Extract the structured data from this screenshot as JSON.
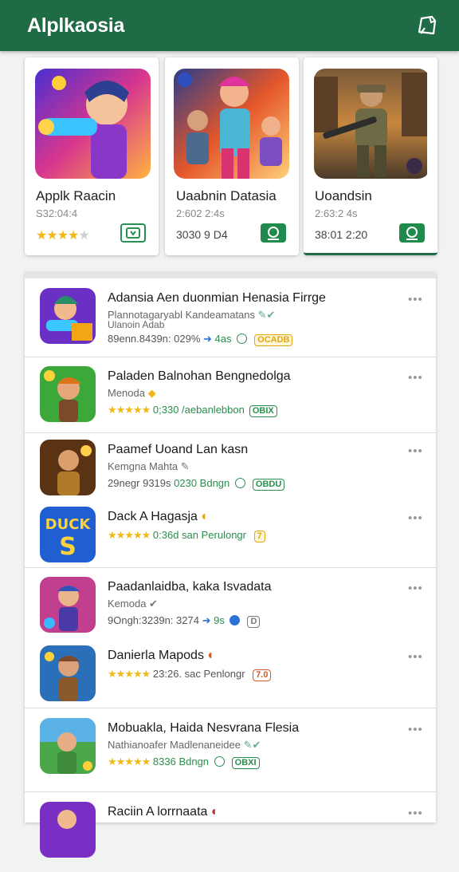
{
  "app": {
    "title": "Alplkaosia",
    "action_icon": "note-edit-icon",
    "accent": "#1e6b45"
  },
  "featured": [
    {
      "name": "Applk Raacin",
      "meta": "S32:04:4",
      "rating": 4,
      "badge_style": "outline",
      "badge_icon": "install-icon"
    },
    {
      "name": "Uaabnin Datasia",
      "meta": "2:602 2:4s",
      "extra": "3030 9 D4",
      "badge_style": "filled",
      "badge_icon": "install-icon",
      "selected": false
    },
    {
      "name": "Uoandsin",
      "meta": "2:63:2 4s",
      "extra": "38:01 2:20",
      "badge_style": "filled",
      "badge_icon": "install-icon",
      "selected": true
    }
  ],
  "list": [
    {
      "title": "Adansia Aen duonmian Henasia Firrge",
      "subtitle": "Plannotagaryabl Kandeamatans",
      "subtitle2": "Ulanoin Adab",
      "meta": "89enn.8439n: 029%",
      "meta_extra": "4as",
      "tag": "OCADB",
      "tag_style": "yellow"
    },
    {
      "title": "Paladen Balnohan Bengnedolga",
      "subtitle": "Menoda",
      "meta": "0;330 /aebanlebbon",
      "tag": "OBIX",
      "tag_style": "green",
      "rating": 5
    },
    {
      "title": "Paamef Uoand Lan kasn",
      "subtitle": "Kemgna Mahta",
      "meta": "29negr 9319s",
      "meta_extra": "0230 Bdngn",
      "tag": "OBDU",
      "tag_style": "green"
    },
    {
      "title": "Dack A Hagasja",
      "subtitle": "",
      "meta": "0:36d san Perulongr",
      "tag": "7",
      "tag_style": "yellow",
      "rating": 5
    },
    {
      "title": "Paadanlaidba, kaka Isvadata",
      "subtitle": "Kemoda",
      "meta": "9Ongh:3239n: 3274",
      "meta_extra": "9s",
      "tag": "D",
      "tag_style": "blue"
    },
    {
      "title": "Danierla Mapods",
      "subtitle": "",
      "meta": "23:26. sac Penlongr",
      "tag": "7.0",
      "tag_style": "red",
      "rating": 5
    },
    {
      "title": "Mobuakla, Haida Nesvrana Flesia",
      "subtitle": "Nathianoafer Madlenaneidee",
      "meta": "8336 Bdngn",
      "tag": "OBXI",
      "tag_style": "green",
      "rating": 5
    },
    {
      "title": "Raciin A lorrnaata",
      "subtitle": "",
      "meta": "",
      "tag": "",
      "tag_style": "red"
    }
  ]
}
